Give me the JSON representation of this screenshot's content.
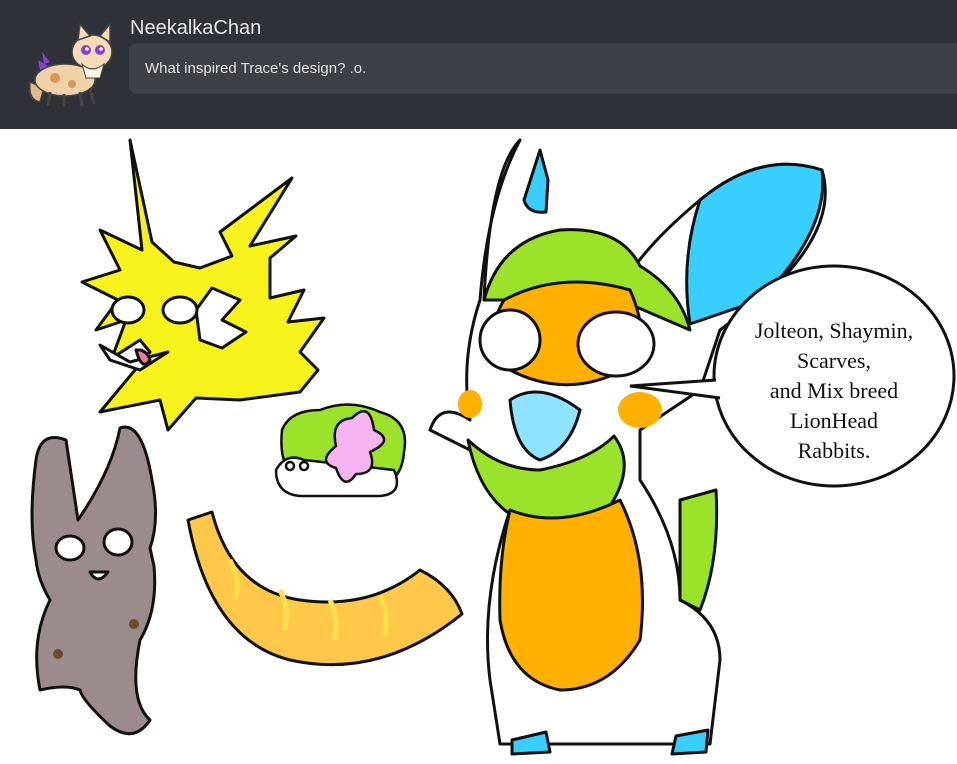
{
  "question": {
    "asker_name": "NeekalkaChan",
    "text": "What inspired Trace's design? .o."
  },
  "answer": {
    "speech_lines": [
      "Jolteon, Shaymin,",
      "Scarves,",
      "and Mix breed",
      "LionHead",
      "Rabbits."
    ]
  },
  "colors": {
    "header_bg": "#2f3238",
    "bubble_bg": "#3d4047",
    "jolteon_yellow": "#f7f21c",
    "trace_orange": "#ffb000",
    "trace_green": "#9be22b",
    "trace_blue": "#38cfff",
    "scarf_orange": "#ffc84a",
    "rabbit_brown": "#9c8b8c"
  }
}
